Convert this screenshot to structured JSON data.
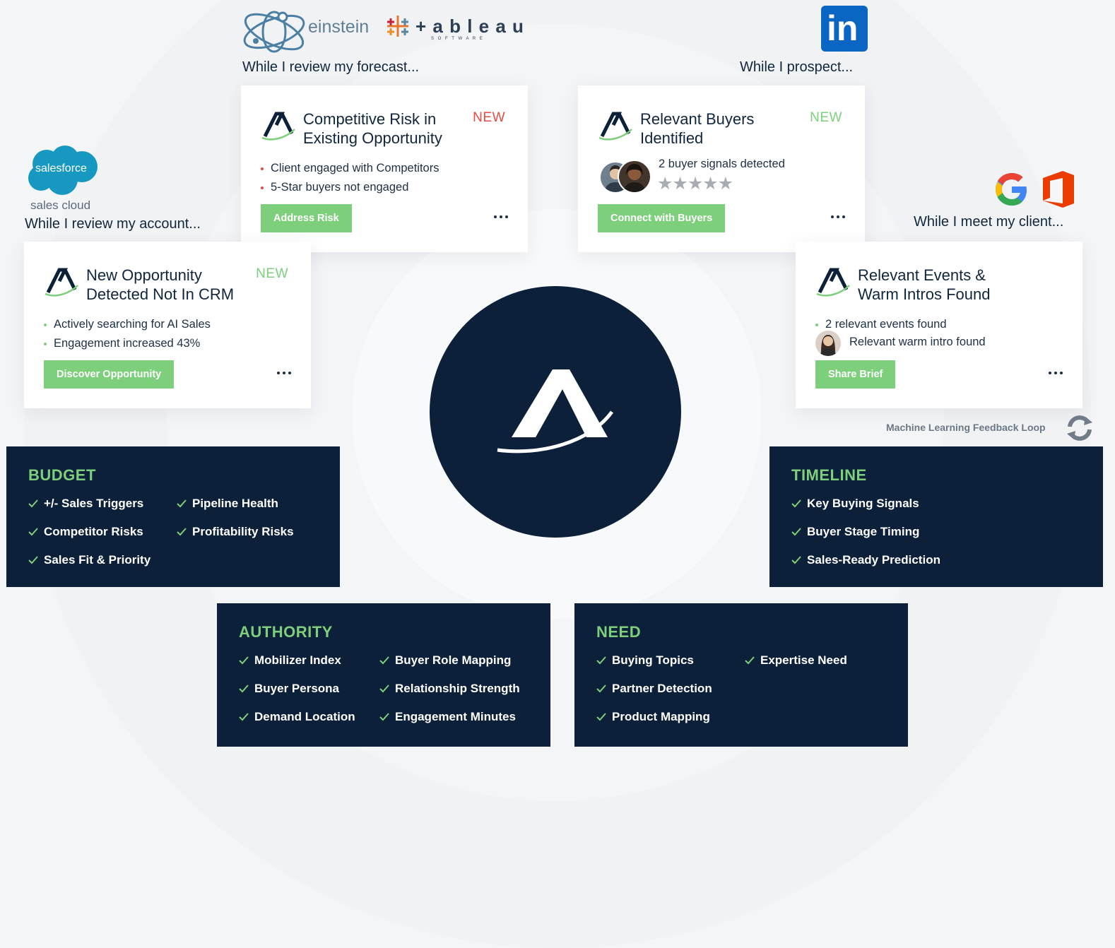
{
  "captions": {
    "forecast": "While I review my forecast...",
    "prospect": "While I prospect...",
    "account": "While I review my account...",
    "client": "While I meet my client..."
  },
  "logos": {
    "einstein": "einstein",
    "tableau": "+ a b l e a u",
    "tableau_sub": "S O F T W A R E",
    "salesforce": "salesforce",
    "sales_cloud": "sales cloud",
    "linkedin": "in"
  },
  "cards": {
    "competitive": {
      "title_line1": "Competitive Risk in",
      "title_line2": "Existing Opportunity",
      "badge": "NEW",
      "bullets": [
        "Client engaged with Competitors",
        "5-Star buyers not engaged"
      ],
      "cta": "Address Risk"
    },
    "buyers": {
      "title_line1": "Relevant Buyers",
      "title_line2": "Identified",
      "badge": "NEW",
      "signal": "2 buyer signals detected",
      "stars": "★★★★★",
      "cta": "Connect with Buyers"
    },
    "opportunity": {
      "title_line1": "New Opportunity",
      "title_line2": "Detected Not In CRM",
      "badge": "NEW",
      "bullets": [
        "Actively searching for AI Sales",
        "Engagement increased 43%"
      ],
      "cta": "Discover Opportunity"
    },
    "events": {
      "title_line1": "Relevant Events &",
      "title_line2": "Warm Intros Found",
      "bullets": [
        "2 relevant events found"
      ],
      "intro": "Relevant warm intro found",
      "cta": "Share Brief"
    }
  },
  "feedback_loop": "Machine Learning Feedback Loop",
  "panels": {
    "budget": {
      "heading": "BUDGET",
      "items": [
        "+/- Sales Triggers",
        "Competitor Risks",
        "Sales Fit & Priority",
        "Pipeline Health",
        "Profitability Risks"
      ]
    },
    "timeline": {
      "heading": "TIMELINE",
      "items": [
        "Key Buying Signals",
        "Buyer Stage Timing",
        "Sales-Ready Prediction"
      ]
    },
    "authority": {
      "heading": "AUTHORITY",
      "items": [
        "Mobilizer Index",
        "Buyer Persona",
        "Demand Location",
        "Buyer Role Mapping",
        "Relationship Strength",
        "Engagement Minutes"
      ]
    },
    "need": {
      "heading": "NEED",
      "items": [
        "Buying Topics",
        "Partner Detection",
        "Product Mapping",
        "Expertise Need"
      ]
    }
  },
  "colors": {
    "navy": "#0c2039",
    "accent_green": "#7ecf7c",
    "alert_red": "#e74b44",
    "linkedin_blue": "#0a66c2",
    "salesforce_blue": "#1798c1"
  }
}
